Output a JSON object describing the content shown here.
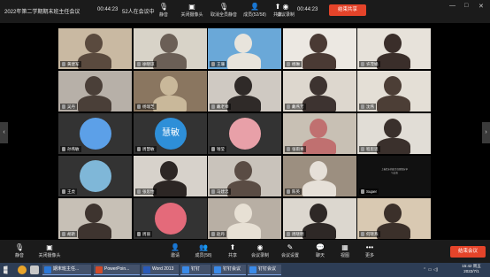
{
  "meeting": {
    "title": "2022年第二学期期末班主任会议",
    "elapsed": "00:44:23",
    "online_count": "52人在会议中",
    "clock": "00:44:23"
  },
  "top_toolbar": [
    {
      "icon": "mic-off-icon",
      "glyph": "🎙",
      "label": "静音"
    },
    {
      "icon": "camera-icon",
      "glyph": "▣",
      "label": "关闭摄像头"
    },
    {
      "icon": "unmute-all-icon",
      "glyph": "🎙",
      "label": "取消全员静音"
    },
    {
      "icon": "members-icon",
      "glyph": "👤",
      "label": "成员(52/58)"
    },
    {
      "icon": "record-icon",
      "glyph": "◉",
      "label": "会议录制"
    },
    {
      "icon": "share-icon",
      "glyph": "⬆",
      "label": "共享"
    }
  ],
  "end_meeting_label": "结束共享",
  "window_controls": [
    "—",
    "□",
    "✕"
  ],
  "participants": [
    {
      "name": "黄建军",
      "bg": "#c9b9a2",
      "person": "#5a4a3e"
    },
    {
      "name": "徐晓琼",
      "bg": "#d8d3c8",
      "person": "#6b5f56"
    },
    {
      "name": "王珊",
      "bg": "#6aa8d8",
      "person": "#e8e4dc"
    },
    {
      "name": "杨琳",
      "bg": "#ece8e2",
      "person": "#4a3a34"
    },
    {
      "name": "许茂娟",
      "bg": "#e7e2da",
      "person": "#3a2e2a"
    },
    {
      "name": "吴丹",
      "bg": "#b7b0a8",
      "person": "#4a3f38"
    },
    {
      "name": "杨瑞芝",
      "bg": "#8a7660",
      "person": "#c9b89a"
    },
    {
      "name": "戴老师",
      "bg": "#cfc9c2",
      "person": "#2f2a28"
    },
    {
      "name": "戴燕芳",
      "bg": "#ddd7ce",
      "person": "#3d3330"
    },
    {
      "name": "沈燕",
      "bg": "#e4dfd6",
      "person": "#4c3e36"
    },
    {
      "name": "孙燕敏",
      "bg": "#333333",
      "avatar": "avatar-default",
      "avatar_color": "#5ca0e8",
      "avatar_text": ""
    },
    {
      "name": "周慧敏",
      "bg": "#333333",
      "avatar": "avatar-text",
      "avatar_color": "#2e8fd8",
      "avatar_text": "慧敏"
    },
    {
      "name": "钱莹",
      "bg": "#333333",
      "avatar": "avatar-flower",
      "avatar_color": "#e8a0a8",
      "avatar_text": ""
    },
    {
      "name": "张雨青",
      "bg": "#c8c0b4",
      "person": "#c07070"
    },
    {
      "name": "程思思",
      "bg": "#e1ddd6",
      "person": "#3a302c"
    },
    {
      "name": "王虎",
      "bg": "#333333",
      "avatar": "avatar-tree",
      "avatar_color": "#7fb7d8",
      "avatar_text": ""
    },
    {
      "name": "张思怡",
      "bg": "#d7d2cb",
      "person": "#2c2624"
    },
    {
      "name": "马建忠",
      "bg": "#c9c3bb",
      "person": "#5a4c44"
    },
    {
      "name": "陈英",
      "bg": "#9c8f80",
      "person": "#e6e0d8"
    },
    {
      "name": "Super",
      "bg": "#111111",
      "card": "上善若水的班主任感悟分享与交流"
    },
    {
      "name": "胡艳",
      "bg": "#c7c0b6",
      "person": "#3e342f"
    },
    {
      "name": "周丽",
      "bg": "#333333",
      "avatar": "avatar-rose",
      "avatar_color": "#e46a7a",
      "avatar_text": ""
    },
    {
      "name": "赵丹",
      "bg": "#b8afa4",
      "person": "#e7e0d4"
    },
    {
      "name": "周晓明",
      "bg": "#dcd7cf",
      "person": "#2e2826"
    },
    {
      "name": "何晓燕",
      "bg": "#d9c9b2",
      "person": "#3b302a"
    }
  ],
  "bottom_toolbar": [
    {
      "icon": "mic-icon",
      "glyph": "🎙",
      "label": "静音"
    },
    {
      "icon": "camera-icon",
      "glyph": "▣",
      "label": "关闭摄像头"
    },
    {
      "icon": "invite-icon",
      "glyph": "👤",
      "label": "邀请"
    },
    {
      "icon": "members-icon",
      "glyph": "👥",
      "label": "成员(58)"
    },
    {
      "icon": "share-icon",
      "glyph": "⬆",
      "label": "共享"
    },
    {
      "icon": "record-icon",
      "glyph": "◉",
      "label": "会议录制"
    },
    {
      "icon": "settings-icon",
      "glyph": "✎",
      "label": "会议设置"
    },
    {
      "icon": "chat-icon",
      "glyph": "💬",
      "label": "聊天"
    },
    {
      "icon": "view-icon",
      "glyph": "▦",
      "label": "视图"
    },
    {
      "icon": "more-icon",
      "glyph": "•••",
      "label": "更多"
    }
  ],
  "end_bottom_label": "结束会议",
  "taskbar": {
    "tasks": [
      {
        "label": "期末班主任...",
        "color": "#2b78d8"
      },
      {
        "label": "PowerPoin...",
        "color": "#d04a2a"
      },
      {
        "label": "Word 2013",
        "color": "#2a5ab8"
      },
      {
        "label": "钉钉",
        "color": "#3a8ae8"
      },
      {
        "label": "钉钉会议",
        "color": "#3a8ae8"
      },
      {
        "label": "钉钉会议",
        "color": "#3a8ae8"
      }
    ],
    "clock_time": "15:42 周五",
    "clock_date": "2022/7/1"
  }
}
